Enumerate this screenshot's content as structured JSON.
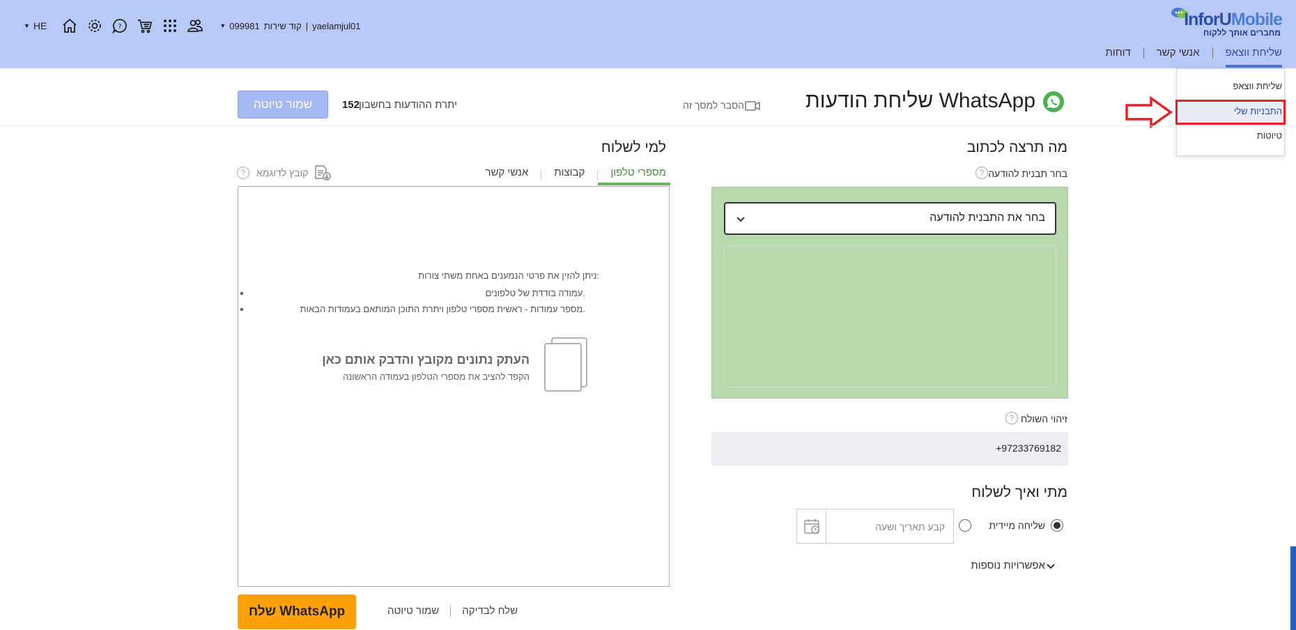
{
  "header": {
    "logo_text_a": "InforU",
    "logo_text_b": "Mobile",
    "logo_tagline": "מחברים אותך ללקוח",
    "nav": [
      {
        "label": "שליחת ווצאפ"
      },
      {
        "label": "אנשי קשר"
      },
      {
        "label": "דוחות"
      }
    ],
    "username": "yaelamjul01",
    "service_label": "קוד שירות",
    "service_sep": "|",
    "service_code": "099981",
    "lang": "HE",
    "icons": [
      "home-icon",
      "gear-icon",
      "help-chat-icon",
      "cart-icon",
      "apps-grid-icon",
      "users-icon"
    ]
  },
  "dropdown": {
    "items": [
      {
        "label": "שליחת ווצאפ"
      },
      {
        "label": "התבניות שלי"
      },
      {
        "label": "טיוטות"
      }
    ]
  },
  "page": {
    "title": "שליחת הודעות WhatsApp",
    "explain_link": "הסבר למסך זה",
    "remaining_label": "יתרת ההודעות בחשבון",
    "remaining_count": "152",
    "save_draft_top": "שמור טיוטה"
  },
  "compose": {
    "title": "מה תרצה לכתוב",
    "template_label": "בחר תבנית להודעה",
    "template_select": "בחר את התבנית להודעה",
    "sender_label": "זיהוי השולח",
    "sender_value": "+97233769182",
    "when_title": "מתי ואיך לשלוח",
    "send_now": "שליחה מיידית",
    "date_placeholder": "קבע תאריך ושעה",
    "more_options": "אפשרויות נוספות"
  },
  "recipients": {
    "title": "למי לשלוח",
    "tabs": [
      {
        "label": "מספרי טלפון"
      },
      {
        "label": "קבוצות"
      },
      {
        "label": "אנשי קשר"
      }
    ],
    "sample_file": "קובץ לדוגמא",
    "instructions_intro": "ניתן להזין את פרטי הנמענים באחת משתי צורות:",
    "instructions_1": "עמודה בודדת של טלפונים.",
    "instructions_2": "מספר עמודות - ראשית מספרי טלפון ויתרת התוכן המותאם בעמודות הבאות.",
    "paste_title": "העתק נתונים מקובץ והדבק אותם כאן",
    "paste_sub": "הקפד להציב את מספרי הטלפון בעמודה הראשונה"
  },
  "footer": {
    "send_button": "שלח WhatsApp",
    "test_send": "שלח לבדיקה",
    "save_draft": "שמור טיוטה"
  },
  "colors": {
    "header_bg": "#b8c9f8",
    "template_bg": "#b8d9ad",
    "send_button": "#ffa20a",
    "highlight": "#e32228"
  }
}
